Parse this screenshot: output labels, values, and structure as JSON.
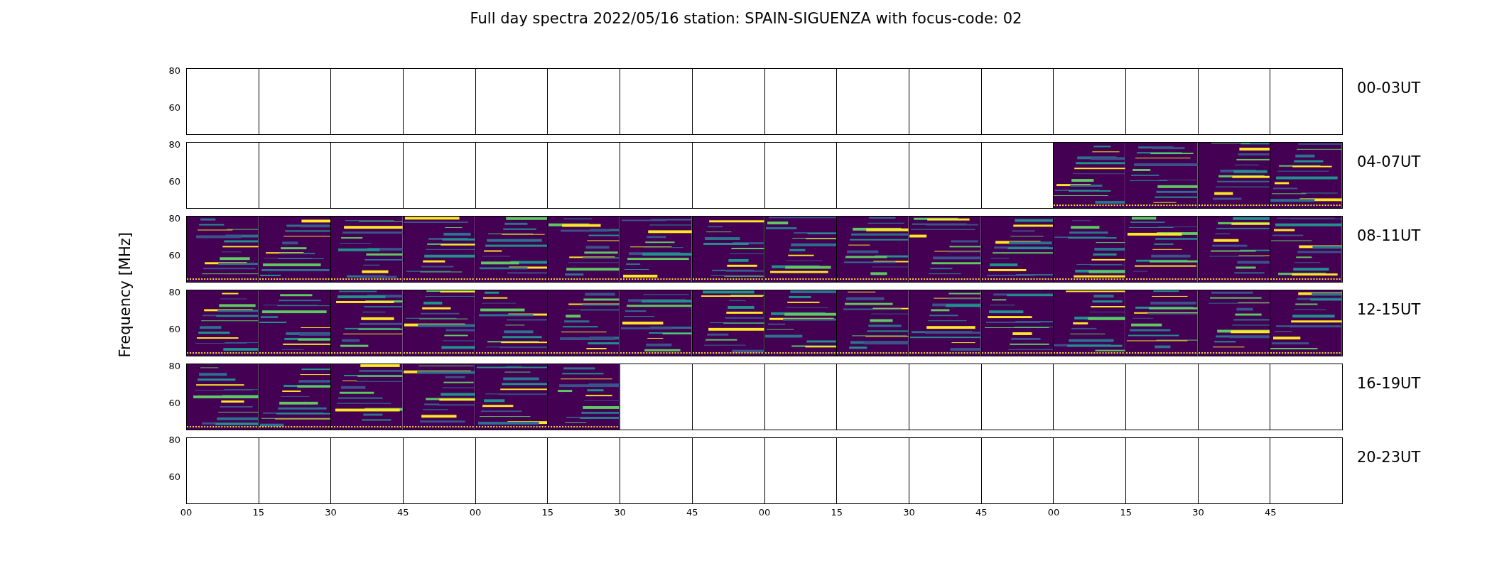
{
  "title": "Full day spectra 2022/05/16 station: SPAIN-SIGUENZA with focus-code: 02",
  "y_axis_label": "Frequency [MHz]",
  "rows": [
    {
      "label": "00-03UT",
      "y_ticks": [
        "80",
        "60"
      ],
      "panels": [
        {
          "kind": "empty"
        },
        {
          "kind": "empty"
        },
        {
          "kind": "empty"
        },
        {
          "kind": "empty"
        },
        {
          "kind": "empty"
        },
        {
          "kind": "empty"
        },
        {
          "kind": "empty"
        },
        {
          "kind": "empty"
        },
        {
          "kind": "empty"
        },
        {
          "kind": "empty"
        },
        {
          "kind": "empty"
        },
        {
          "kind": "empty"
        },
        {
          "kind": "empty"
        },
        {
          "kind": "empty"
        },
        {
          "kind": "empty"
        },
        {
          "kind": "empty"
        }
      ]
    },
    {
      "label": "04-07UT",
      "y_ticks": [
        "80",
        "60"
      ],
      "panels": [
        {
          "kind": "empty"
        },
        {
          "kind": "empty"
        },
        {
          "kind": "empty"
        },
        {
          "kind": "empty"
        },
        {
          "kind": "empty"
        },
        {
          "kind": "empty"
        },
        {
          "kind": "empty"
        },
        {
          "kind": "empty"
        },
        {
          "kind": "empty"
        },
        {
          "kind": "empty"
        },
        {
          "kind": "empty"
        },
        {
          "kind": "empty"
        },
        {
          "kind": "spectrum"
        },
        {
          "kind": "spectrum"
        },
        {
          "kind": "spectrum"
        },
        {
          "kind": "spectrum"
        }
      ]
    },
    {
      "label": "08-11UT",
      "y_ticks": [
        "80",
        "60"
      ],
      "panels": [
        {
          "kind": "spectrum"
        },
        {
          "kind": "spectrum"
        },
        {
          "kind": "spectrum"
        },
        {
          "kind": "spectrum"
        },
        {
          "kind": "spectrum"
        },
        {
          "kind": "spectrum"
        },
        {
          "kind": "spectrum"
        },
        {
          "kind": "spectrum"
        },
        {
          "kind": "spectrum"
        },
        {
          "kind": "spectrum"
        },
        {
          "kind": "spectrum"
        },
        {
          "kind": "spectrum"
        },
        {
          "kind": "spectrum"
        },
        {
          "kind": "spectrum"
        },
        {
          "kind": "spectrum"
        },
        {
          "kind": "spectrum"
        }
      ]
    },
    {
      "label": "12-15UT",
      "y_ticks": [
        "80",
        "60"
      ],
      "panels": [
        {
          "kind": "spectrum"
        },
        {
          "kind": "spectrum"
        },
        {
          "kind": "spectrum"
        },
        {
          "kind": "spectrum"
        },
        {
          "kind": "spectrum"
        },
        {
          "kind": "spectrum"
        },
        {
          "kind": "spectrum"
        },
        {
          "kind": "spectrum"
        },
        {
          "kind": "spectrum"
        },
        {
          "kind": "spectrum"
        },
        {
          "kind": "spectrum"
        },
        {
          "kind": "spectrum"
        },
        {
          "kind": "spectrum"
        },
        {
          "kind": "spectrum"
        },
        {
          "kind": "spectrum"
        },
        {
          "kind": "spectrum"
        }
      ]
    },
    {
      "label": "16-19UT",
      "y_ticks": [
        "80",
        "60"
      ],
      "panels": [
        {
          "kind": "spectrum"
        },
        {
          "kind": "spectrum"
        },
        {
          "kind": "spectrum"
        },
        {
          "kind": "spectrum"
        },
        {
          "kind": "spectrum"
        },
        {
          "kind": "spectrum"
        },
        {
          "kind": "empty"
        },
        {
          "kind": "empty"
        },
        {
          "kind": "empty"
        },
        {
          "kind": "empty"
        },
        {
          "kind": "empty"
        },
        {
          "kind": "empty"
        },
        {
          "kind": "empty"
        },
        {
          "kind": "empty"
        },
        {
          "kind": "empty"
        },
        {
          "kind": "empty"
        }
      ]
    },
    {
      "label": "20-23UT",
      "y_ticks": [
        "80",
        "60"
      ],
      "panels": [
        {
          "kind": "empty"
        },
        {
          "kind": "empty"
        },
        {
          "kind": "empty"
        },
        {
          "kind": "empty"
        },
        {
          "kind": "empty"
        },
        {
          "kind": "empty"
        },
        {
          "kind": "empty"
        },
        {
          "kind": "empty"
        },
        {
          "kind": "empty"
        },
        {
          "kind": "empty"
        },
        {
          "kind": "empty"
        },
        {
          "kind": "empty"
        },
        {
          "kind": "empty"
        },
        {
          "kind": "empty"
        },
        {
          "kind": "empty"
        },
        {
          "kind": "empty"
        }
      ]
    }
  ],
  "x_ticks": [
    "00",
    "15",
    "30",
    "45",
    "00",
    "15",
    "30",
    "45",
    "00",
    "15",
    "30",
    "45",
    "00",
    "15",
    "30",
    "45"
  ]
}
